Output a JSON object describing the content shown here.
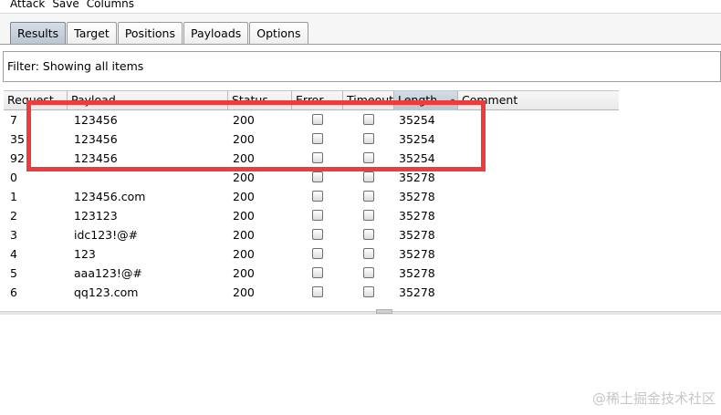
{
  "menu": [
    "Attack",
    "Save",
    "Columns"
  ],
  "tabs": [
    {
      "label": "Results",
      "active": true
    },
    {
      "label": "Target",
      "active": false
    },
    {
      "label": "Positions",
      "active": false
    },
    {
      "label": "Payloads",
      "active": false
    },
    {
      "label": "Options",
      "active": false
    }
  ],
  "filter": {
    "text": "Filter: Showing all items"
  },
  "table": {
    "columns": [
      "Request",
      "Payload",
      "Status",
      "Error",
      "Timeout",
      "Length",
      "Comment"
    ],
    "sorted_column": "Length",
    "rows": [
      {
        "request": "7",
        "payload": "123456",
        "status": "200",
        "error": false,
        "timeout": false,
        "length": "35254",
        "comment": ""
      },
      {
        "request": "35",
        "payload": "123456",
        "status": "200",
        "error": false,
        "timeout": false,
        "length": "35254",
        "comment": ""
      },
      {
        "request": "92",
        "payload": "123456",
        "status": "200",
        "error": false,
        "timeout": false,
        "length": "35254",
        "comment": ""
      },
      {
        "request": "0",
        "payload": "",
        "status": "200",
        "error": false,
        "timeout": false,
        "length": "35278",
        "comment": ""
      },
      {
        "request": "1",
        "payload": "123456.com",
        "status": "200",
        "error": false,
        "timeout": false,
        "length": "35278",
        "comment": ""
      },
      {
        "request": "2",
        "payload": "123123",
        "status": "200",
        "error": false,
        "timeout": false,
        "length": "35278",
        "comment": ""
      },
      {
        "request": "3",
        "payload": "idc123!@#",
        "status": "200",
        "error": false,
        "timeout": false,
        "length": "35278",
        "comment": ""
      },
      {
        "request": "4",
        "payload": "123",
        "status": "200",
        "error": false,
        "timeout": false,
        "length": "35278",
        "comment": ""
      },
      {
        "request": "5",
        "payload": "aaa123!@#",
        "status": "200",
        "error": false,
        "timeout": false,
        "length": "35278",
        "comment": ""
      },
      {
        "request": "6",
        "payload": "qq123.com",
        "status": "200",
        "error": false,
        "timeout": false,
        "length": "35278",
        "comment": ""
      }
    ]
  },
  "annotation_color": "#ee3b3b",
  "watermark": "@稀土掘金技术社区"
}
